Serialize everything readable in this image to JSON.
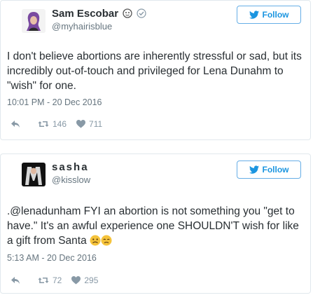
{
  "tweets": [
    {
      "display_name": "Sam Escobar",
      "handle": "@myhairisblue",
      "follow_label": "Follow",
      "text": "I don't believe abortions are inherently stressful or sad, but its incredibly out-of-touch and privileged for Lena Dunahm to \"wish\" for one.",
      "timestamp": "10:01 PM - 20 Dec 2016",
      "retweets": "146",
      "likes": "711"
    },
    {
      "display_name": "sasha",
      "handle": "@kisslow",
      "follow_label": "Follow",
      "text": ".@lenadunham FYI an abortion is not something you \"get to have.\" It's an awful experience one SHOULDN'T wish for like a gift from Santa",
      "timestamp": "5:13 AM - 20 Dec 2016",
      "retweets": "72",
      "likes": "295"
    }
  ],
  "colors": {
    "link_blue": "#1b95e0",
    "muted_gray": "#66757f",
    "action_gray": "#8899a6",
    "border": "#e1e8ed"
  },
  "icons": [
    "reply-icon",
    "retweet-icon",
    "heart-icon",
    "verified-icon",
    "bird-icon",
    "emoji-sad-face-icon"
  ]
}
